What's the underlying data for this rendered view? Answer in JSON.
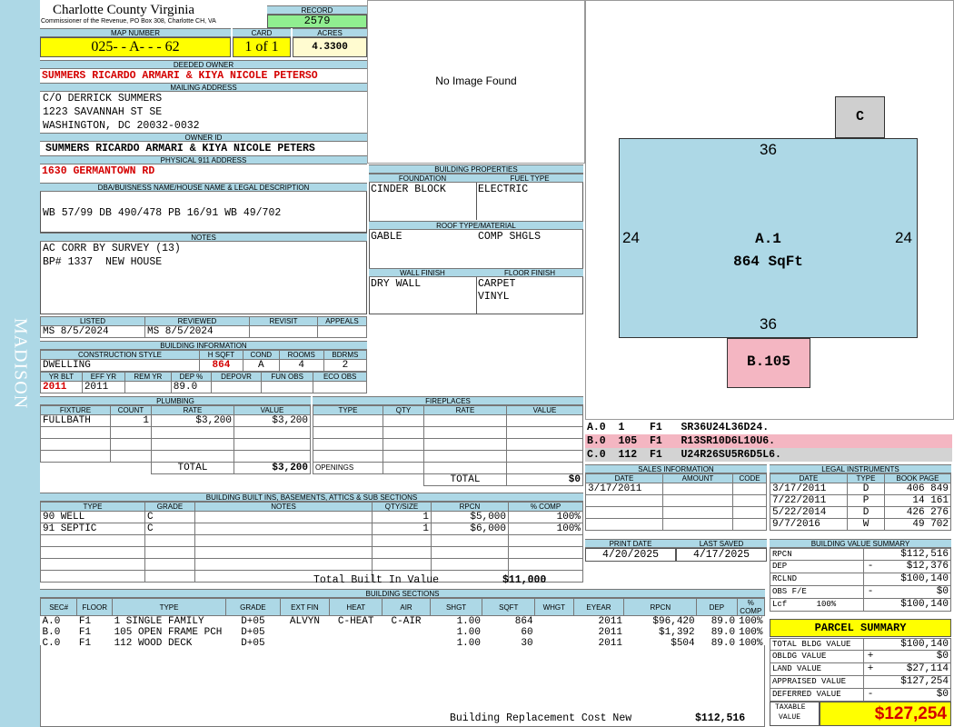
{
  "side_label": "MADISON",
  "header": {
    "county": "Charlotte County Virginia",
    "office": "Commissioner of the Revenue, PO Box 308, Charlotte CH, VA"
  },
  "record": {
    "label": "RECORD",
    "value": "2579"
  },
  "map": {
    "label": "MAP NUMBER",
    "value": "025- - A- - - 62"
  },
  "card": {
    "label": "CARD",
    "value": "1 of 1"
  },
  "acres": {
    "label": "ACRES",
    "value": "4.3300"
  },
  "deeded_owner": {
    "label": "DEEDED OWNER",
    "value": "SUMMERS RICARDO ARMARI & KIYA NICOLE PETERSO"
  },
  "mailing": {
    "label": "MAILING ADDRESS",
    "line1": "C/O DERRICK SUMMERS",
    "line2": "1223 SAVANNAH ST SE",
    "line3": "WASHINGTON, DC 20032-0032"
  },
  "owner_id": {
    "label": "OWNER ID",
    "value": "SUMMERS RICARDO ARMARI & KIYA NICOLE PETERS"
  },
  "physical": {
    "label": "PHYSICAL 911 ADDRESS",
    "value": "1630 GERMANTOWN RD"
  },
  "legal": {
    "label": "DBA/BUISNESS NAME/HOUSE NAME & LEGAL DESCRIPTION",
    "value": "WB 57/99 DB 490/478 PB 16/91 WB 49/702"
  },
  "notes": {
    "label": "NOTES",
    "line1": "AC CORR BY SURVEY (13)",
    "line2": "BP# 1337  NEW HOUSE"
  },
  "listed": {
    "listed_label": "LISTED",
    "reviewed_label": "REVIEWED",
    "revisit_label": "REVISIT",
    "appeals_label": "APPEALS",
    "listed_value": "MS    8/5/2024",
    "reviewed_value": "MS    8/5/2024"
  },
  "building_info": {
    "label": "BUILDING INFORMATION",
    "style_label": "CONSTRUCTION STYLE",
    "hsqft_label": "H SQFT",
    "cond_label": "COND",
    "rooms_label": "ROOMS",
    "bdrms_label": "BDRMS",
    "style": "DWELLING",
    "hsqft": "864",
    "cond": "A",
    "rooms": "4",
    "bdrms": "2",
    "yrblt_label": "YR BLT",
    "effyr_label": "EFF YR",
    "remyr_label": "REM YR",
    "dep_label": "DEP %",
    "depovr_label": "DEPOVR",
    "funobs_label": "FUN OBS",
    "ecoobs_label": "ECO OBS",
    "yrblt": "2011",
    "effyr": "2011",
    "dep": "89.0"
  },
  "plumbing": {
    "label": "PLUMBING",
    "cols": [
      "FIXTURE",
      "COUNT",
      "RATE",
      "VALUE"
    ],
    "rows": [
      [
        "FULLBATH",
        "1",
        "$3,200",
        "$3,200"
      ]
    ],
    "total_label": "TOTAL",
    "total": "$3,200"
  },
  "fireplaces": {
    "label": "FIREPLACES",
    "cols": [
      "TYPE",
      "QTY",
      "RATE",
      "VALUE"
    ],
    "openings_label": "OPENINGS",
    "total_label": "TOTAL",
    "total": "$0"
  },
  "builtins": {
    "label": "BUILDING BUILT INS, BASEMENTS, ATTICS & SUB SECTIONS",
    "cols": [
      "TYPE",
      "GRADE",
      "NOTES",
      "QTY/SIZE",
      "RPCN",
      "% COMP"
    ],
    "rows": [
      [
        "90 WELL",
        "C",
        "",
        "1",
        "$5,000",
        "100%"
      ],
      [
        "91 SEPTIC",
        "C",
        "",
        "1",
        "$6,000",
        "100%"
      ]
    ],
    "total_label": "Total Built In Value",
    "total": "$11,000"
  },
  "sections": {
    "label": "BUILDING SECTIONS",
    "cols": [
      "SEC#",
      "FLOOR",
      "TYPE",
      "GRADE",
      "EXT FIN",
      "HEAT",
      "AIR",
      "SHGT",
      "SQFT",
      "WHGT",
      "EYEAR",
      "RPCN",
      "DEP",
      "% COMP"
    ],
    "rows": [
      [
        "A.0",
        "F1",
        "1 SINGLE FAMILY",
        "D+05",
        "ALVYN",
        "C-HEAT",
        "C-AIR",
        "1.00",
        "864",
        "",
        "2011",
        "$96,420",
        "89.0",
        "100%"
      ],
      [
        "B.0",
        "F1",
        "105 OPEN FRAME PCH",
        "D+05",
        "",
        "",
        "",
        "1.00",
        "60",
        "",
        "2011",
        "$1,392",
        "89.0",
        "100%"
      ],
      [
        "C.0",
        "F1",
        "112 WOOD DECK",
        "D+05",
        "",
        "",
        "",
        "1.00",
        "30",
        "",
        "2011",
        "$504",
        "89.0",
        "100%"
      ]
    ],
    "replacement_label": "Building Replacement Cost New",
    "replacement": "$112,516"
  },
  "image": {
    "text": "No Image Found"
  },
  "building_properties": {
    "label": "BUILDING PROPERTIES",
    "foundation_label": "FOUNDATION",
    "fuel_label": "FUEL TYPE",
    "foundation": "CINDER BLOCK",
    "fuel": "ELECTRIC",
    "roof_label": "ROOF TYPE/MATERIAL",
    "roof_type": "GABLE",
    "roof_material": "COMP SHGLS",
    "wall_label": "WALL FINISH",
    "floor_label": "FLOOR FINISH",
    "wall": "DRY WALL",
    "floor1": "CARPET",
    "floor2": "VINYL"
  },
  "sketch": {
    "main_label": "A.1",
    "main_area": "864 SqFt",
    "top": "36",
    "bottom": "36",
    "left": "24",
    "right": "24",
    "b_label": "B.105",
    "c_label": "C",
    "main_color": "#add8e6",
    "b_color": "#f4b6c2",
    "c_color": "#cfcfcf"
  },
  "sketch_lines": [
    {
      "text": "A.0  1    F1   SR36U24L36D24.",
      "color": "#ffffff"
    },
    {
      "text": "B.0  105  F1   R13SR10D6L10U6.",
      "color": "#f4b6c2"
    },
    {
      "text": "C.0  112  F1   U24R26SU5R6D5L6.",
      "color": "#d3d3d3"
    }
  ],
  "sales": {
    "label": "SALES INFORMATION",
    "cols": [
      "DATE",
      "AMOUNT",
      "CODE"
    ],
    "rows": [
      [
        "3/17/2011",
        "",
        ""
      ]
    ]
  },
  "print": {
    "print_label": "PRINT DATE",
    "saved_label": "LAST SAVED",
    "print_date": "4/20/2025",
    "last_saved": "4/17/2025"
  },
  "legal_instruments": {
    "label": "LEGAL INSTRUMENTS",
    "cols": [
      "DATE",
      "TYPE",
      "BOOK PAGE"
    ],
    "rows": [
      [
        "3/17/2011",
        "D",
        "406 849"
      ],
      [
        "7/22/2011",
        "P",
        "14 161"
      ],
      [
        "5/22/2014",
        "D",
        "426 276"
      ],
      [
        "9/7/2016",
        "W",
        "49 702"
      ]
    ]
  },
  "value_summary": {
    "label": "BUILDING VALUE SUMMARY",
    "rows": [
      {
        "name": "RPCN",
        "op": "",
        "value": "$112,516"
      },
      {
        "name": "DEP",
        "op": "-",
        "value": "$12,376"
      },
      {
        "name": "RCLND",
        "op": "",
        "value": "$100,140"
      },
      {
        "name": "OBS F/E",
        "op": "-",
        "value": "$0"
      },
      {
        "name": "Lcf      100%",
        "op": "",
        "value": "$100,140"
      }
    ]
  },
  "parcel": {
    "label": "PARCEL SUMMARY",
    "rows": [
      {
        "name": "TOTAL BLDG VALUE",
        "op": "",
        "value": "$100,140"
      },
      {
        "name": "OBLDG VALUE",
        "op": "+",
        "value": "$0"
      },
      {
        "name": "LAND VALUE",
        "op": "+",
        "value": "$27,114"
      },
      {
        "name": "APPRAISED VALUE",
        "op": "",
        "value": "$127,254"
      },
      {
        "name": "DEFERRED VALUE",
        "op": "-",
        "value": "$0"
      }
    ],
    "taxable_label1": "TAXABLE",
    "taxable_label2": "VALUE",
    "taxable": "$127,254",
    "header_color": "#ffff00",
    "taxable_color": "#d40000"
  }
}
